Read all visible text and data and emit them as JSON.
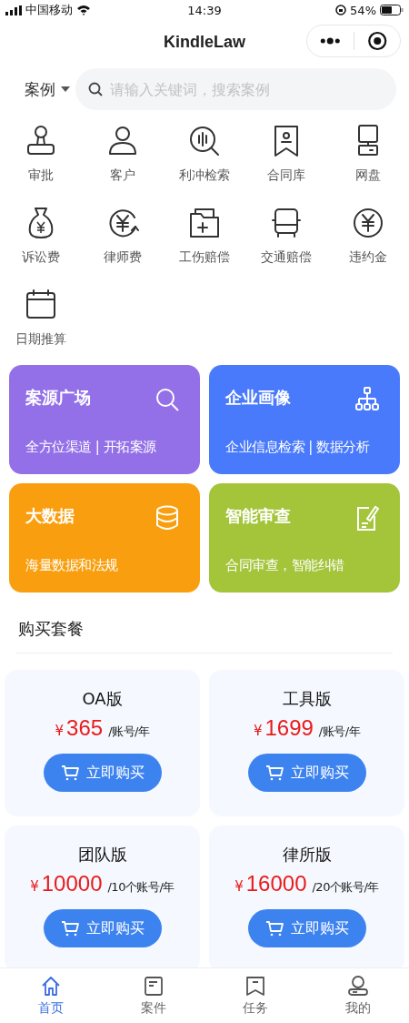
{
  "status_bar": {
    "carrier": "中国移动",
    "time": "14:39",
    "battery": "54%"
  },
  "nav": {
    "title": "KindleLaw"
  },
  "search": {
    "scope": "案例",
    "placeholder": "请输入关键词，搜索案例"
  },
  "shortcuts": [
    {
      "label": "审批"
    },
    {
      "label": "客户"
    },
    {
      "label": "利冲检索"
    },
    {
      "label": "合同库"
    },
    {
      "label": "网盘"
    },
    {
      "label": "诉讼费"
    },
    {
      "label": "律师费"
    },
    {
      "label": "工伤赔偿"
    },
    {
      "label": "交通赔偿"
    },
    {
      "label": "违约金"
    },
    {
      "label": "日期推算"
    }
  ],
  "features": [
    {
      "title": "案源广场",
      "subtitle": "全方位渠道 | 开拓案源",
      "color": "#9370e8"
    },
    {
      "title": "企业画像",
      "subtitle": "企业信息检索 | 数据分析",
      "color": "#4a7afc"
    },
    {
      "title": "大数据",
      "subtitle": "海量数据和法规",
      "color": "#f99f0f"
    },
    {
      "title": "智能审查",
      "subtitle": "合同审查，智能纠错",
      "color": "#a4c43a"
    }
  ],
  "section_title": "购买套餐",
  "plans": [
    {
      "name": "OA版",
      "currency": "¥",
      "price": "365",
      "unit": "/账号/年",
      "button": "立即购买"
    },
    {
      "name": "工具版",
      "currency": "¥",
      "price": "1699",
      "unit": "/账号/年",
      "button": "立即购买"
    },
    {
      "name": "团队版",
      "currency": "¥",
      "price": "10000",
      "unit": "/10个账号/年",
      "button": "立即购买"
    },
    {
      "name": "律所版",
      "currency": "¥",
      "price": "16000",
      "unit": "/20个账号/年",
      "button": "立即购买"
    }
  ],
  "tabs": [
    {
      "label": "首页",
      "selected": true
    },
    {
      "label": "案件",
      "selected": false
    },
    {
      "label": "任务",
      "selected": false
    },
    {
      "label": "我的",
      "selected": false
    }
  ]
}
